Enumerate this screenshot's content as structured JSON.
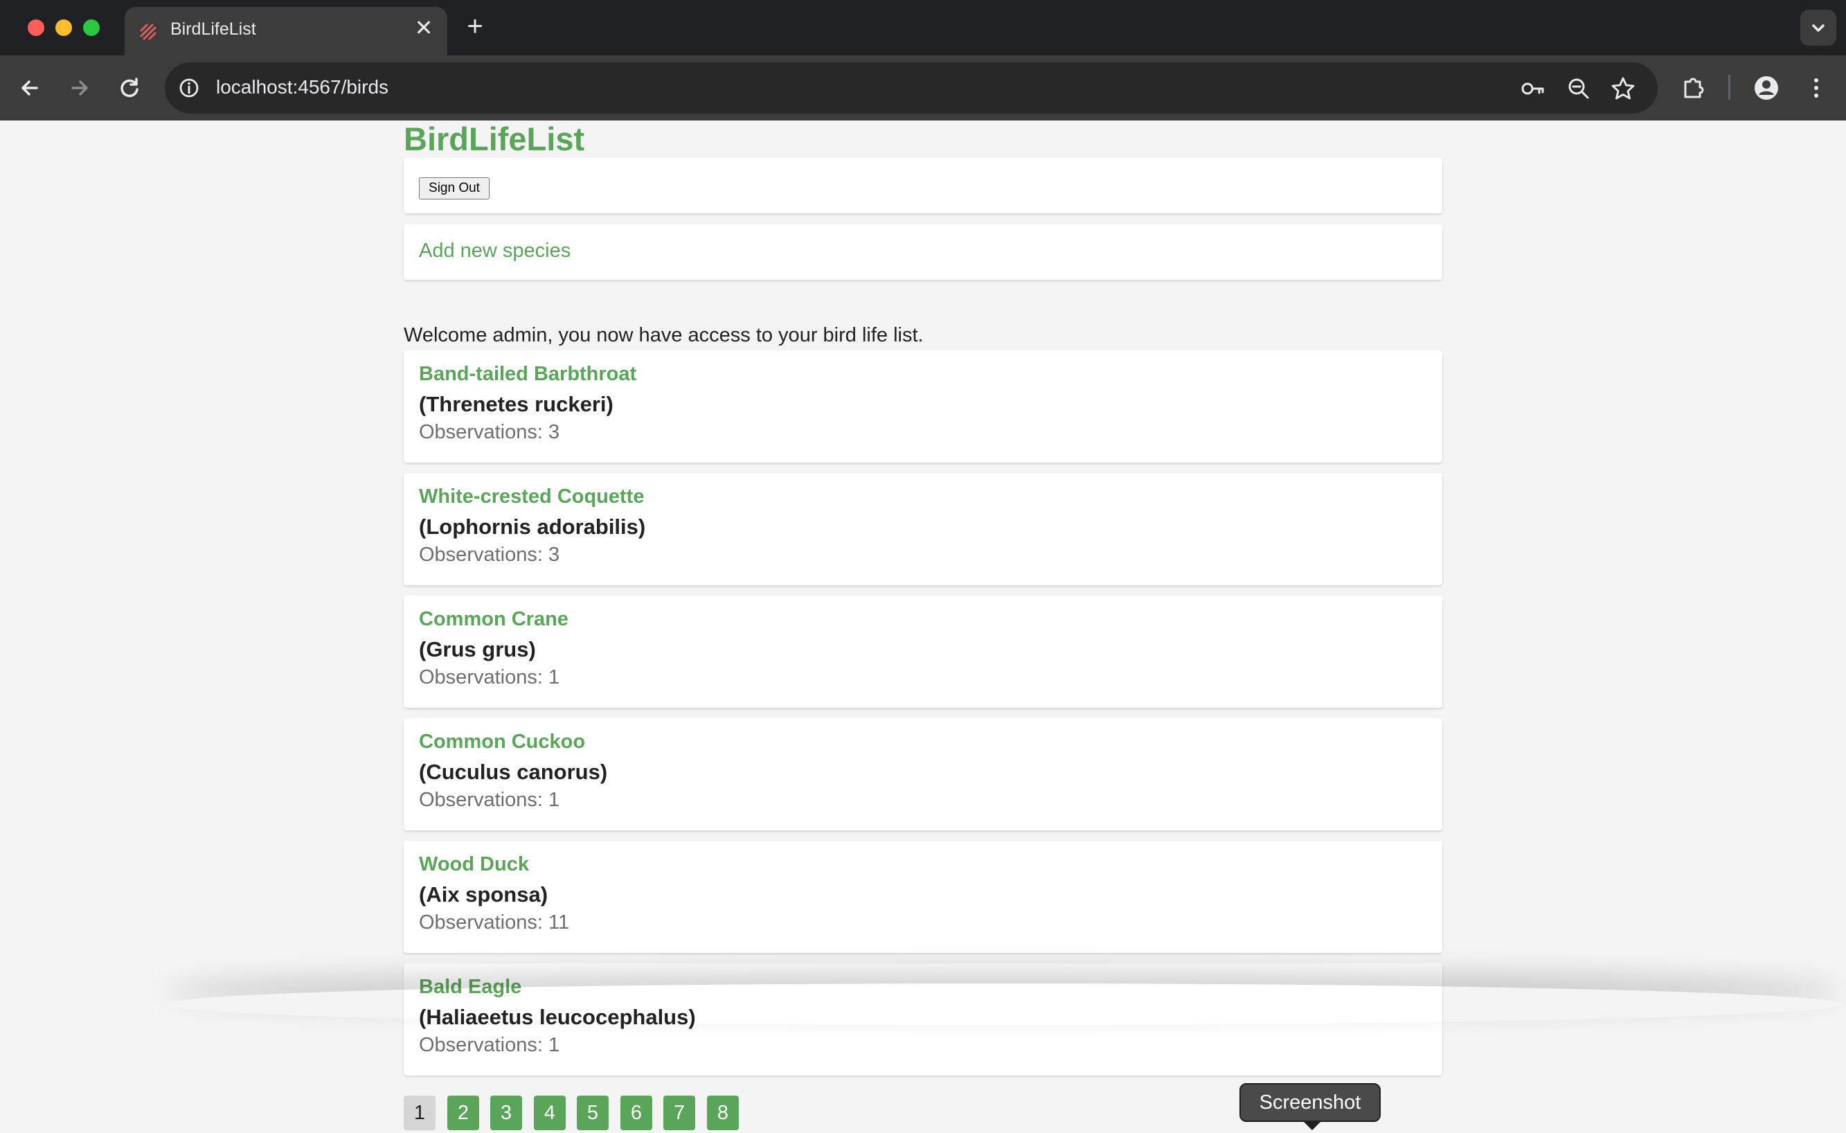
{
  "browser": {
    "tab_title": "BirdLifeList",
    "new_tab_symbol": "+",
    "close_symbol": "✕",
    "url": "localhost:4567/birds"
  },
  "page": {
    "site_title": "BirdLifeList",
    "sign_out_label": "Sign Out",
    "add_species_label": "Add new species",
    "welcome_text": "Welcome admin, you now have access to your bird life list.",
    "birds": [
      {
        "name": "Band-tailed Barbthroat",
        "scientific": "(Threnetes ruckeri)",
        "observations": "Observations: 3"
      },
      {
        "name": "White-crested Coquette",
        "scientific": "(Lophornis adorabilis)",
        "observations": "Observations: 3"
      },
      {
        "name": "Common Crane",
        "scientific": "(Grus grus)",
        "observations": "Observations: 1"
      },
      {
        "name": "Common Cuckoo",
        "scientific": "(Cuculus canorus)",
        "observations": "Observations: 1"
      },
      {
        "name": "Wood Duck",
        "scientific": "(Aix sponsa)",
        "observations": "Observations: 11"
      },
      {
        "name": "Bald Eagle",
        "scientific": "(Haliaeetus leucocephalus)",
        "observations": "Observations: 1"
      }
    ],
    "pagination": [
      "1",
      "2",
      "3",
      "4",
      "5",
      "6",
      "7",
      "8"
    ],
    "current_page": "1"
  },
  "overlay": {
    "tooltip_text": "Screenshot"
  },
  "colors": {
    "accent_green": "#5aa55a",
    "page_background": "#f4f4f4",
    "chrome_dark": "#202124",
    "toolbar": "#3c3c3c"
  },
  "icons": [
    "back-arrow-icon",
    "forward-arrow-icon",
    "reload-icon",
    "site-info-icon",
    "password-key-icon",
    "zoom-icon",
    "bookmark-star-icon",
    "extensions-icon",
    "profile-icon",
    "more-menu-icon",
    "tab-list-chevron-icon"
  ]
}
